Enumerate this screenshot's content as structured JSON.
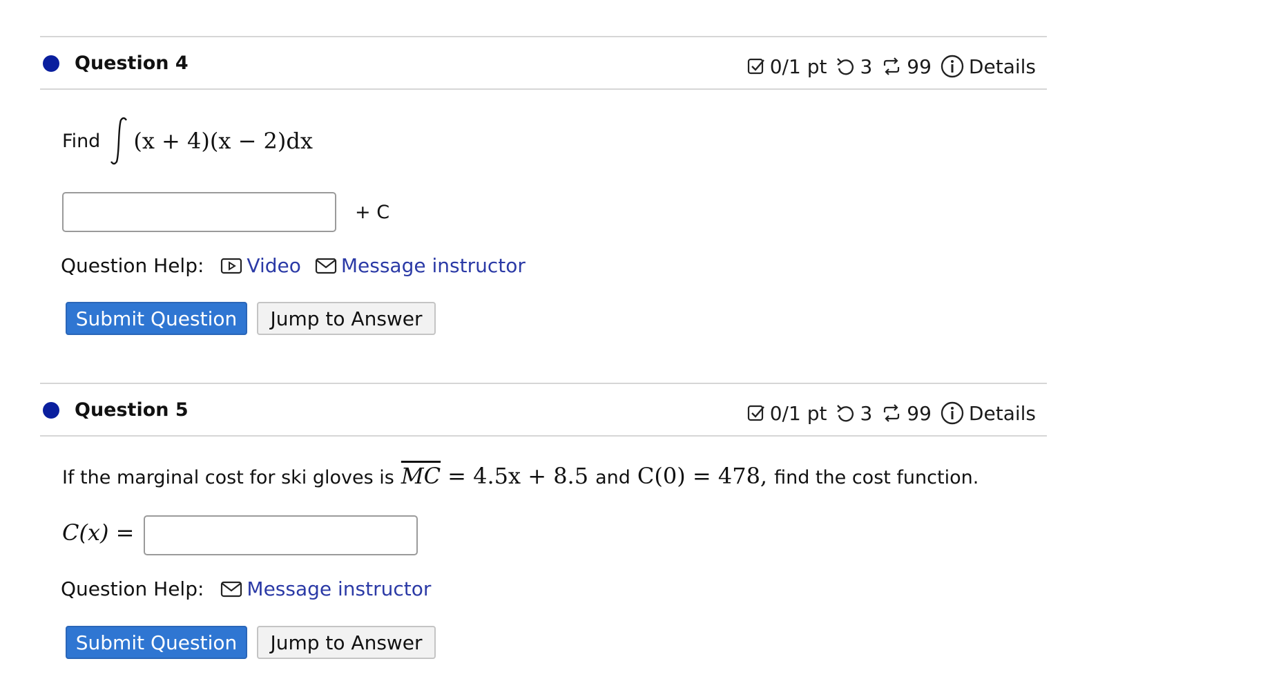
{
  "questions": [
    {
      "title": "Question 4",
      "meta": {
        "score": "0/1 pt",
        "retries": "3",
        "attempts": "99",
        "details": "Details"
      },
      "prompt_text": "Find",
      "math": {
        "integrand": "(x + 4)(x − 2)dx"
      },
      "suffix": "+ C",
      "help_label": "Question Help:",
      "help_links": [
        "Video",
        "Message instructor"
      ],
      "submit_label": "Submit Question",
      "jump_label": "Jump to Answer"
    },
    {
      "title": "Question 5",
      "meta": {
        "score": "0/1 pt",
        "retries": "3",
        "attempts": "99",
        "details": "Details"
      },
      "prompt_text_1": "If the marginal cost for ski gloves is",
      "math_mc": "MC",
      "math_mc_rhs": "= 4.5x + 8.5",
      "prompt_text_2": "and",
      "math_c0": "C(0) = 478,",
      "prompt_text_3": "find the cost function.",
      "answer_label": "C(x) =",
      "help_label": "Question Help:",
      "help_links": [
        "Message instructor"
      ],
      "submit_label": "Submit Question",
      "jump_label": "Jump to Answer"
    }
  ],
  "colors": {
    "accent": "#2f76d2",
    "link": "#2b3aa6",
    "dot": "#0a1f9e"
  }
}
